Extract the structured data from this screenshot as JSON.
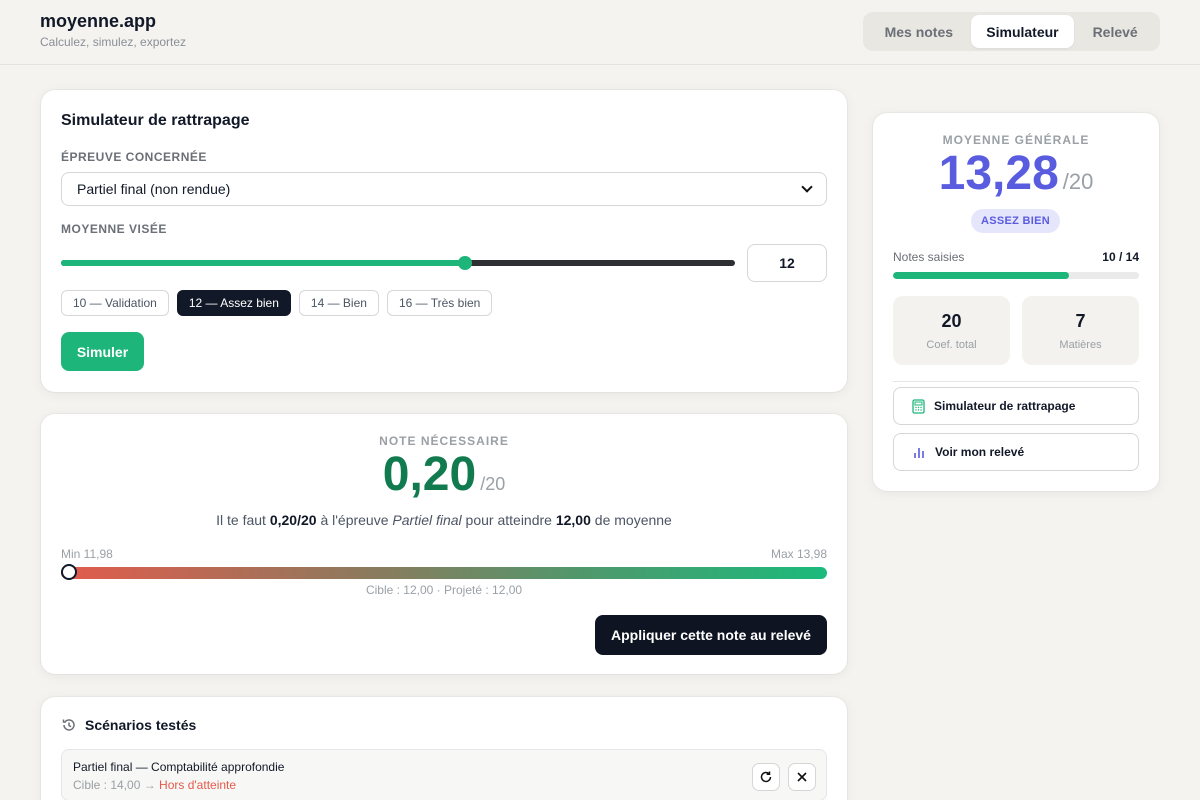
{
  "app": {
    "title": "moyenne.app",
    "subtitle": "Calculez, simulez, exportez"
  },
  "nav": {
    "tabs": [
      "Mes notes",
      "Simulateur",
      "Relevé"
    ],
    "active": "Simulateur"
  },
  "simulator": {
    "title": "Simulateur de rattrapage",
    "exam_label": "Épreuve concernée",
    "exam_selected": "Partiel final (non rendue)",
    "target_label": "Moyenne visée",
    "target_value": "12",
    "slider_fraction": 0.6,
    "chips": [
      "10 — Validation",
      "12 — Assez bien",
      "14 — Bien",
      "16 — Très bien"
    ],
    "active_chip": "12 — Assez bien",
    "simulate_label": "Simuler"
  },
  "result": {
    "label": "NOTE NÉCESSAIRE",
    "value": "0,20",
    "denom": "/20",
    "sentence": {
      "pre": "Il te faut ",
      "note": "0,20/20",
      "mid1": " à l'épreuve ",
      "exam": "Partiel final",
      "mid2": " pour atteindre ",
      "target": "12,00",
      "post": " de moyenne"
    },
    "min_label": "Min 11,98",
    "max_label": "Max 13,98",
    "marker_fraction": 0.01,
    "range_note": "Cible : 12,00 · Projeté : 12,00",
    "apply_label": "Appliquer cette note au relevé"
  },
  "scenarios": {
    "title": "Scénarios testés",
    "items": [
      {
        "title": "Partiel final — Comptabilité approfondie",
        "target": "Cible : 14,00 → ",
        "status": "Hors d'atteinte"
      }
    ]
  },
  "summary": {
    "label": "MOYENNE GÉNÉRALE",
    "value": "13,28",
    "denom": "/20",
    "badge": "ASSEZ BIEN",
    "notes_label": "Notes saisies",
    "notes_count": "10 / 14",
    "notes_fraction": 0.714,
    "coef_total": "20",
    "coef_label": "Coef. total",
    "subjects": "7",
    "subjects_label": "Matières",
    "link_simulator": "Simulateur de rattrapage",
    "link_releve": "Voir mon relevé"
  },
  "colors": {
    "accent": "#1db57a",
    "primary": "#5a5ce0",
    "result": "#117a4f",
    "danger": "#e35b4d",
    "dark": "#0f1422"
  }
}
